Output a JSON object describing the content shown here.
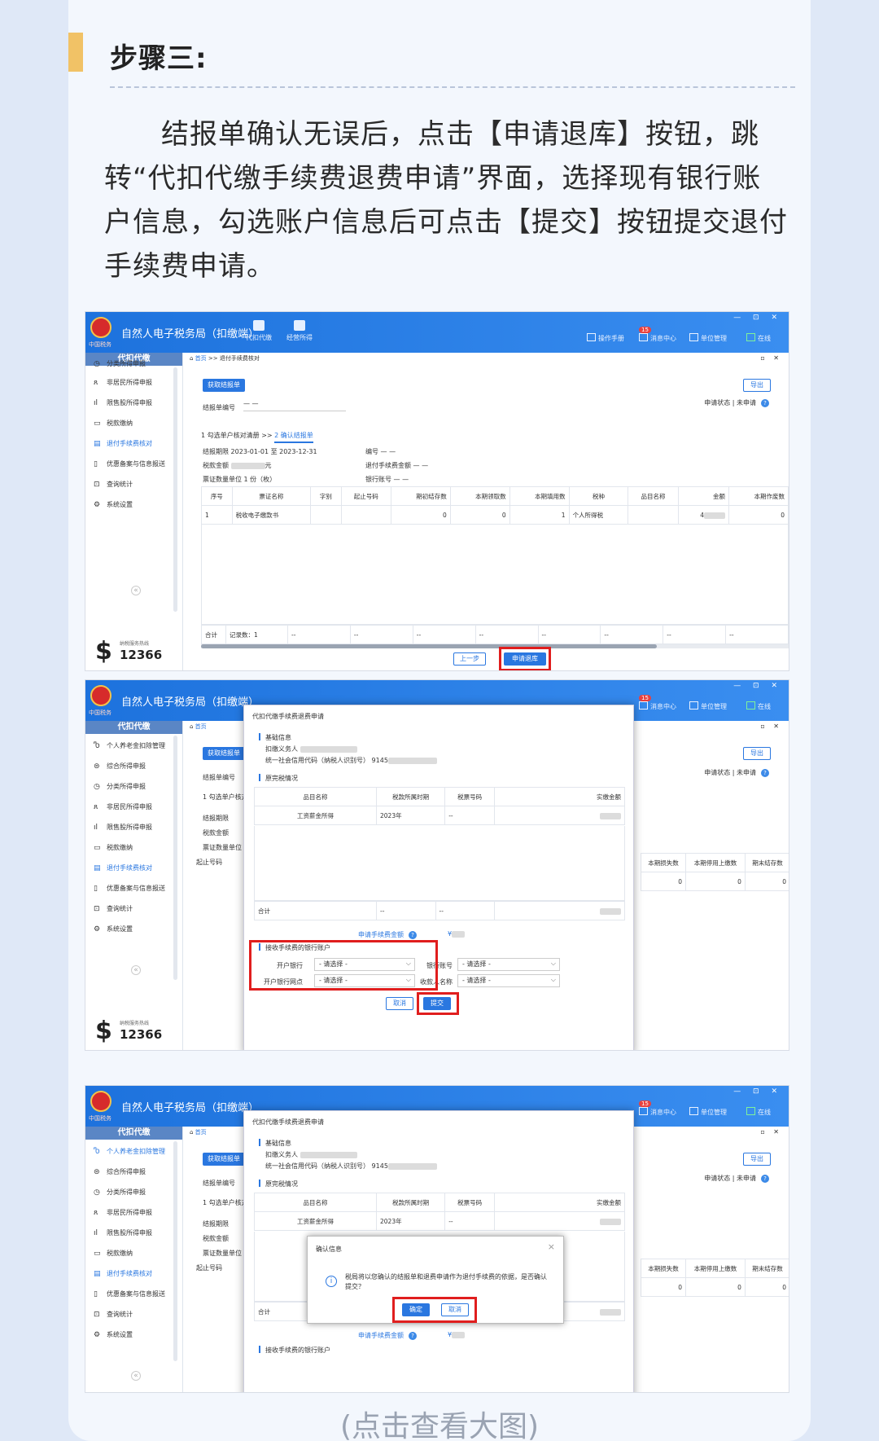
{
  "article": {
    "step_title": "步骤三:",
    "paragraph": "结报单确认无误后，点击【申请退库】按钮，跳转“代扣代缴手续费退费申请”界面，选择现有银行账户信息，勾选账户信息后可点击【提交】按钮提交退付手续费申请。",
    "caption": "(点击查看大图)"
  },
  "app": {
    "title": "自然人电子税务局（扣缴端）",
    "emblem_caption": "中国税务",
    "nav": [
      "代扣代缴",
      "经营所得"
    ],
    "header_right": {
      "manual": "操作手册",
      "message": "消息中心",
      "message_badge": "15",
      "unit": "单位管理",
      "online": "在线"
    },
    "window_controls": "— ⊡ ✕",
    "sidebar_title": "代扣代缴",
    "hotline_label": "纳税服务热线",
    "hotline_number": "12366",
    "sidebar_items": [
      {
        "icon": "Ⴊ",
        "label": "个人养老金扣除管理"
      },
      {
        "icon": "⊜",
        "label": "综合所得申报"
      },
      {
        "icon": "◷",
        "label": "分类所得申报"
      },
      {
        "icon": "ጸ",
        "label": "非居民所得申报"
      },
      {
        "icon": "ıl",
        "label": "限售股所得申报"
      },
      {
        "icon": "▭",
        "label": "税款缴纳"
      },
      {
        "icon": "▤",
        "label": "退付手续费核对"
      },
      {
        "icon": "▯",
        "label": "优惠备案与信息报送"
      },
      {
        "icon": "⊡",
        "label": "查询统计"
      },
      {
        "icon": "⚙",
        "label": "系统设置"
      }
    ],
    "collapse": "«",
    "main_controls": "▫ ✕"
  },
  "s1": {
    "crumb_home": "首页",
    "crumb_rest": " >> 退付手续费核对",
    "get_btn": "获取结报单",
    "export_btn": "导出",
    "serial_label": "结报单编号",
    "serial_value": "— —",
    "status_label": "申请状态",
    "status_value": "未申请",
    "tab1": "1 勾选单户核对清册",
    "tab_sep": ">>",
    "tab2": "2 确认结报单",
    "period_label": "结报期限",
    "period_value": "2023-01-01  至  2023-12-31",
    "amount_label": "税款金额",
    "amount_unit": "元",
    "qty_label": "票证数量单位",
    "qty_value": "1 份（枚）",
    "no_label": "编号",
    "no_value": "— —",
    "fee_label": "退付手续费金额",
    "fee_value": "— —",
    "bank_label": "银行账号",
    "bank_value": "— —",
    "columns": [
      "序号",
      "票证名称",
      "字别",
      "起止号码",
      "期初结存数",
      "本期领取数",
      "本期填用数",
      "税种",
      "品目名称",
      "金额",
      "本期作废数"
    ],
    "row": [
      "1",
      "税收电子缴款书",
      "",
      "",
      "0",
      "0",
      "1",
      "个人所得税",
      "",
      "4",
      "0"
    ],
    "total_label": "合计",
    "record_count": "记录数：1",
    "dash": "--",
    "prev_btn": "上一步",
    "refund_btn": "申请退库"
  },
  "modal": {
    "title": "代扣代缴手续费退费申请",
    "basic_info": "基础信息",
    "withholder": "扣缴义务人",
    "credit_code": "统一社会信用代码（纳税人识别号）",
    "credit_prefix": "9145",
    "original_tax": "原完税情况",
    "columns": [
      "品目名称",
      "税款所属时期",
      "税票号码",
      "实缴金额"
    ],
    "row": [
      "工资薪金所得",
      "2023年",
      "--",
      ""
    ],
    "total": "合计",
    "dash": "--",
    "apply_fee": "申请手续费金额",
    "yen": "¥",
    "bank_account_section": "接收手续费的银行账户",
    "open_bank": "开户银行",
    "open_branch": "开户银行网点",
    "bank_no": "银行账号",
    "payee": "收款人名称",
    "placeholder": "- 请选择 -",
    "cancel": "取消",
    "submit": "提交"
  },
  "behind": {
    "extra_cols": [
      "本期损失数",
      "本期停用上缴数",
      "期末结存数"
    ],
    "extra_vals": [
      "0",
      "0",
      "0"
    ],
    "start_no": "起止号码"
  },
  "confirm": {
    "title": "确认信息",
    "message": "税局将以您确认的结报单和退费申请作为退付手续费的依据，是否确认提交？",
    "ok": "确定",
    "cancel": "取消"
  }
}
